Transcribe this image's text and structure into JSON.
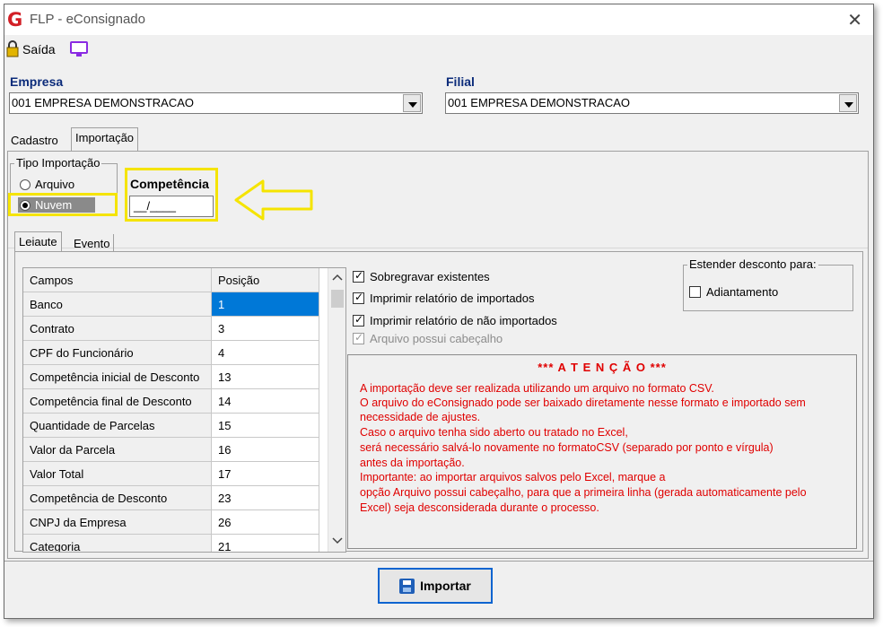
{
  "window": {
    "title": "FLP - eConsignado",
    "close": "✕"
  },
  "toolbar": {
    "exit_label": "Saída"
  },
  "empresa": {
    "label": "Empresa",
    "value": "001 EMPRESA DEMONSTRACAO"
  },
  "filial": {
    "label": "Filial",
    "value": "001 EMPRESA DEMONSTRACAO"
  },
  "main_tabs": [
    {
      "label": "Cadastro"
    },
    {
      "label": "Importação"
    }
  ],
  "tipo_importacao": {
    "legend": "Tipo Importação",
    "options": [
      {
        "label": "Arquivo",
        "selected": false
      },
      {
        "label": "Nuvem",
        "selected": true
      }
    ]
  },
  "competencia": {
    "label": "Competência",
    "value": "__/____"
  },
  "sub_tabs": [
    {
      "label": "Leiaute"
    },
    {
      "label": "Evento"
    }
  ],
  "grid": {
    "headers": [
      "Campos",
      "Posição"
    ],
    "rows": [
      [
        "Banco",
        "1"
      ],
      [
        "Contrato",
        "3"
      ],
      [
        "CPF do Funcionário",
        "4"
      ],
      [
        "Competência inicial de Desconto",
        "13"
      ],
      [
        "Competência final de Desconto",
        "14"
      ],
      [
        "Quantidade de Parcelas",
        "15"
      ],
      [
        "Valor da Parcela",
        "16"
      ],
      [
        "Valor Total",
        "17"
      ],
      [
        "Competência de Desconto",
        "23"
      ],
      [
        "CNPJ da Empresa",
        "26"
      ],
      [
        "Categoria",
        "21"
      ]
    ]
  },
  "options": {
    "sobregravar": {
      "label": "Sobregravar existentes",
      "checked": true
    },
    "imprimir_importados": {
      "label": "Imprimir relatório de importados",
      "checked": true
    },
    "imprimir_nao_importados": {
      "label": "Imprimir relatório de não importados",
      "checked": true
    },
    "cabecalho": {
      "label": "Arquivo possui cabeçalho",
      "checked": true,
      "disabled": true
    }
  },
  "estender": {
    "legend": "Estender desconto para:",
    "adiantamento": "Adiantamento"
  },
  "attention": {
    "title": "*** A T E N Ç Ã O ***",
    "lines": [
      "A importação deve ser realizada utilizando um arquivo no formato CSV.",
      "O arquivo do eConsignado pode ser baixado diretamente nesse formato e importado sem",
      "necessidade de ajustes.",
      "Caso o arquivo tenha sido aberto ou tratado no Excel,",
      "será necessário salvá-lo novamente no formatoCSV (separado por ponto e vírgula)",
      "antes da importação.",
      "Importante: ao importar arquivos salvos pelo Excel, marque a",
      "opção Arquivo possui cabeçalho, para que a primeira linha (gerada automaticamente pelo",
      "Excel) seja desconsiderada durante o processo."
    ]
  },
  "import_button": {
    "label": "Importar"
  },
  "colors": {
    "highlight": "#f5e400",
    "attention": "#e00000",
    "selection": "#0078d7",
    "label_blue": "#0b2b7a"
  }
}
